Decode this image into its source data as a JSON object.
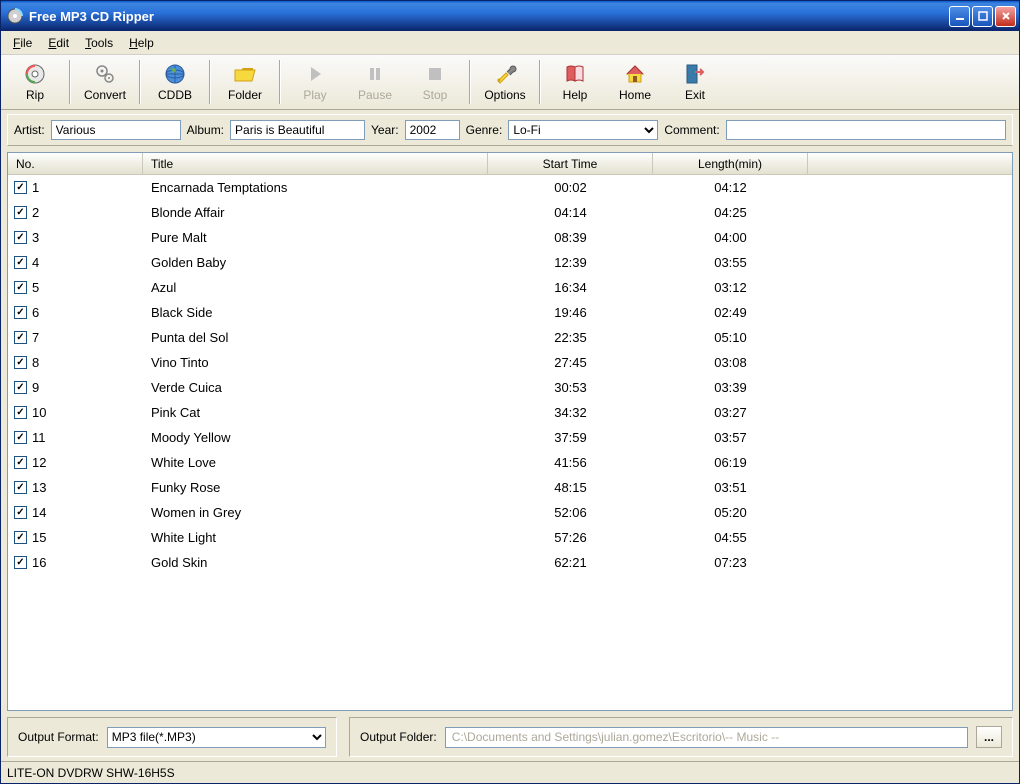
{
  "window": {
    "title": "Free MP3 CD Ripper"
  },
  "menubar": {
    "file": "File",
    "edit": "Edit",
    "tools": "Tools",
    "help": "Help"
  },
  "toolbar": {
    "rip": "Rip",
    "convert": "Convert",
    "cddb": "CDDB",
    "folder": "Folder",
    "play": "Play",
    "pause": "Pause",
    "stop": "Stop",
    "options": "Options",
    "help": "Help",
    "home": "Home",
    "exit": "Exit"
  },
  "info": {
    "artist_label": "Artist:",
    "artist": "Various",
    "album_label": "Album:",
    "album": "Paris is Beautiful",
    "year_label": "Year:",
    "year": "2002",
    "genre_label": "Genre:",
    "genre": "Lo-Fi",
    "comment_label": "Comment:",
    "comment": ""
  },
  "columns": {
    "no": "No.",
    "title": "Title",
    "start": "Start Time",
    "length": "Length(min)"
  },
  "tracks": [
    {
      "no": "1",
      "title": "Encarnada Temptations",
      "start": "00:02",
      "length": "04:12"
    },
    {
      "no": "2",
      "title": "Blonde Affair",
      "start": "04:14",
      "length": "04:25"
    },
    {
      "no": "3",
      "title": "Pure Malt",
      "start": "08:39",
      "length": "04:00"
    },
    {
      "no": "4",
      "title": "Golden Baby",
      "start": "12:39",
      "length": "03:55"
    },
    {
      "no": "5",
      "title": "Azul",
      "start": "16:34",
      "length": "03:12"
    },
    {
      "no": "6",
      "title": "Black Side",
      "start": "19:46",
      "length": "02:49"
    },
    {
      "no": "7",
      "title": "Punta del Sol",
      "start": "22:35",
      "length": "05:10"
    },
    {
      "no": "8",
      "title": "Vino Tinto",
      "start": "27:45",
      "length": "03:08"
    },
    {
      "no": "9",
      "title": "Verde Cuica",
      "start": "30:53",
      "length": "03:39"
    },
    {
      "no": "10",
      "title": "Pink Cat",
      "start": "34:32",
      "length": "03:27"
    },
    {
      "no": "11",
      "title": "Moody Yellow",
      "start": "37:59",
      "length": "03:57"
    },
    {
      "no": "12",
      "title": "White Love",
      "start": "41:56",
      "length": "06:19"
    },
    {
      "no": "13",
      "title": "Funky Rose",
      "start": "48:15",
      "length": "03:51"
    },
    {
      "no": "14",
      "title": "Women in Grey",
      "start": "52:06",
      "length": "05:20"
    },
    {
      "no": "15",
      "title": "White Light",
      "start": "57:26",
      "length": "04:55"
    },
    {
      "no": "16",
      "title": "Gold Skin",
      "start": "62:21",
      "length": "07:23"
    }
  ],
  "output": {
    "format_label": "Output Format:",
    "format": "MP3 file(*.MP3)",
    "folder_label": "Output Folder:",
    "folder": "C:\\Documents and Settings\\julian.gomez\\Escritorio\\-- Music --",
    "browse": "..."
  },
  "status": "LITE-ON DVDRW SHW-16H5S"
}
